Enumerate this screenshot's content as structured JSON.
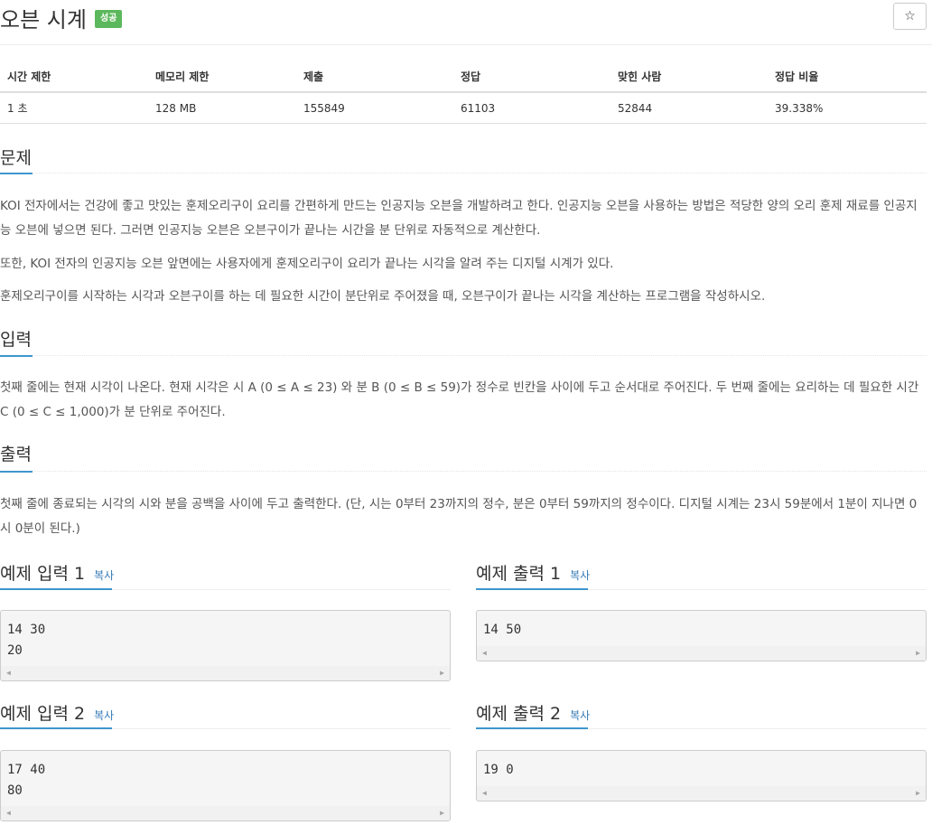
{
  "problem": {
    "title": "오븐 시계",
    "status_badge": "성공",
    "star_icon": "☆"
  },
  "stats": {
    "headers": [
      "시간 제한",
      "메모리 제한",
      "제출",
      "정답",
      "맞힌 사람",
      "정답 비율"
    ],
    "values": [
      "1 초",
      "128 MB",
      "155849",
      "61103",
      "52844",
      "39.338%"
    ]
  },
  "description": {
    "heading": "문제",
    "paragraphs": [
      "KOI 전자에서는 건강에 좋고 맛있는 훈제오리구이 요리를 간편하게 만드는 인공지능 오븐을 개발하려고 한다. 인공지능 오븐을 사용하는 방법은 적당한 양의 오리 훈제 재료를 인공지능 오븐에 넣으면 된다. 그러면 인공지능 오븐은 오븐구이가 끝나는 시간을 분 단위로 자동적으로 계산한다.",
      "또한, KOI 전자의 인공지능 오븐 앞면에는 사용자에게 훈제오리구이 요리가 끝나는 시각을 알려 주는 디지털 시계가 있다.",
      "훈제오리구이를 시작하는 시각과 오븐구이를 하는 데 필요한 시간이 분단위로 주어졌을 때, 오븐구이가 끝나는 시각을 계산하는 프로그램을 작성하시오."
    ]
  },
  "input": {
    "heading": "입력",
    "text": "첫째 줄에는 현재 시각이 나온다. 현재 시각은 시 A (0 ≤ A ≤ 23) 와 분 B (0 ≤ B ≤ 59)가 정수로 빈칸을 사이에 두고 순서대로 주어진다. 두 번째 줄에는 요리하는 데 필요한 시간 C (0 ≤ C ≤ 1,000)가 분 단위로 주어진다."
  },
  "output": {
    "heading": "출력",
    "text": "첫째 줄에 종료되는 시각의 시와 분을 공백을 사이에 두고 출력한다. (단, 시는 0부터 23까지의 정수, 분은 0부터 59까지의 정수이다. 디지털 시계는 23시 59분에서 1분이 지나면 0시 0분이 된다.)"
  },
  "samples": {
    "copy_label": "복사",
    "input1_title": "예제 입력 1",
    "input1": "14 30\n20",
    "output1_title": "예제 출력 1",
    "output1": "14 50",
    "input2_title": "예제 입력 2",
    "input2": "17 40\n80",
    "output2_title": "예제 출력 2",
    "output2": "19 0"
  },
  "icons": {
    "scroll_left": "◀",
    "scroll_right": "▶"
  }
}
